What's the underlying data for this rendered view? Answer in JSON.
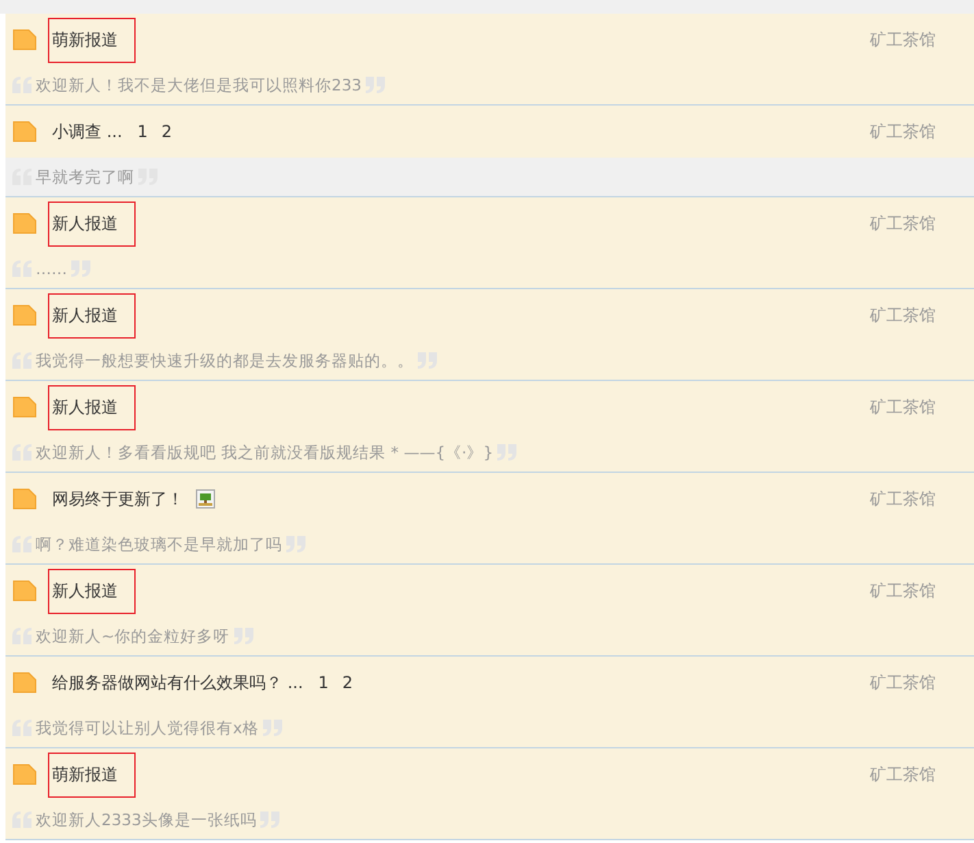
{
  "threads": [
    {
      "title": "萌新报道",
      "highlighted": true,
      "has_image": false,
      "forum": "矿工茶馆",
      "quote": "欢迎新人！我不是大佬但是我可以照料你233",
      "quote_shaded": false
    },
    {
      "title": "小调查 ...",
      "highlighted": false,
      "pages": [
        "1",
        "2"
      ],
      "has_image": false,
      "forum": "矿工茶馆",
      "quote": "早就考完了啊",
      "quote_shaded": true
    },
    {
      "title": "新人报道",
      "highlighted": true,
      "has_image": false,
      "forum": "矿工茶馆",
      "quote": "……",
      "quote_shaded": false
    },
    {
      "title": "新人报道",
      "highlighted": true,
      "has_image": false,
      "forum": "矿工茶馆",
      "quote": "我觉得一般想要快速升级的都是去发服务器贴的。。",
      "quote_shaded": false
    },
    {
      "title": "新人报道",
      "highlighted": true,
      "has_image": false,
      "forum": "矿工茶馆",
      "quote": "欢迎新人！多看看版规吧 我之前就没看版规结果 * ——{《·》}",
      "quote_shaded": false
    },
    {
      "title": "网易终于更新了！",
      "highlighted": false,
      "has_image": true,
      "forum": "矿工茶馆",
      "quote": "啊？难道染色玻璃不是早就加了吗",
      "quote_shaded": false
    },
    {
      "title": "新人报道",
      "highlighted": true,
      "has_image": false,
      "forum": "矿工茶馆",
      "quote": "欢迎新人~你的金粒好多呀",
      "quote_shaded": false
    },
    {
      "title": "给服务器做网站有什么效果吗？ ...",
      "highlighted": false,
      "pages": [
        "1",
        "2"
      ],
      "has_image": false,
      "forum": "矿工茶馆",
      "quote": "我觉得可以让别人觉得很有x格",
      "quote_shaded": false
    },
    {
      "title": "萌新报道",
      "highlighted": true,
      "has_image": false,
      "forum": "矿工茶馆",
      "quote": "欢迎新人2333头像是一张纸吗",
      "quote_shaded": false
    }
  ]
}
